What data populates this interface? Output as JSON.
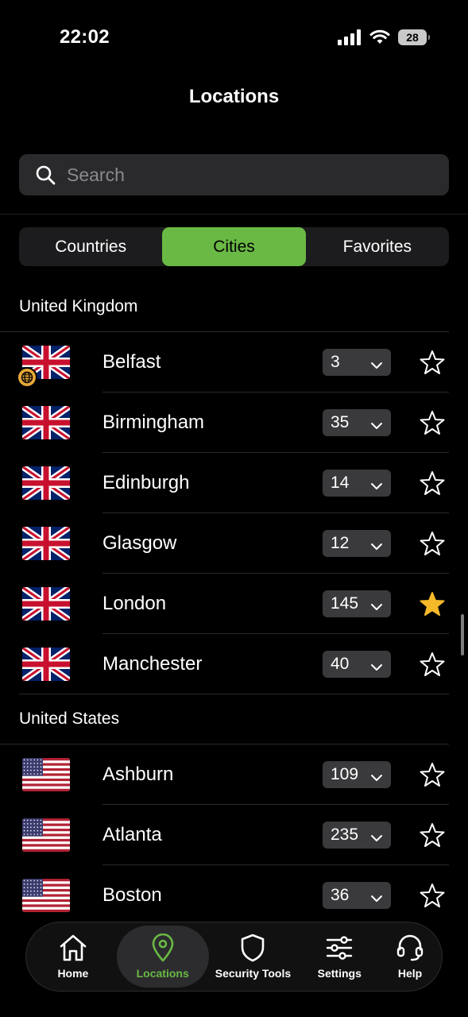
{
  "status_bar": {
    "time": "22:02",
    "battery": "28"
  },
  "page_title": "Locations",
  "search": {
    "placeholder": "Search",
    "value": ""
  },
  "tabs": [
    {
      "label": "Countries",
      "active": false
    },
    {
      "label": "Cities",
      "active": true
    },
    {
      "label": "Favorites",
      "active": false
    }
  ],
  "sections": [
    {
      "header": "United Kingdom",
      "flag": "uk-flag",
      "cities": [
        {
          "name": "Belfast",
          "servers": "3",
          "favorite": false,
          "badge": "globe-icon"
        },
        {
          "name": "Birmingham",
          "servers": "35",
          "favorite": false
        },
        {
          "name": "Edinburgh",
          "servers": "14",
          "favorite": false
        },
        {
          "name": "Glasgow",
          "servers": "12",
          "favorite": false
        },
        {
          "name": "London",
          "servers": "145",
          "favorite": true
        },
        {
          "name": "Manchester",
          "servers": "40",
          "favorite": false
        }
      ]
    },
    {
      "header": "United States",
      "flag": "us-flag",
      "cities": [
        {
          "name": "Ashburn",
          "servers": "109",
          "favorite": false
        },
        {
          "name": "Atlanta",
          "servers": "235",
          "favorite": false
        },
        {
          "name": "Boston",
          "servers": "36",
          "favorite": false
        }
      ]
    }
  ],
  "bottom_nav": [
    {
      "label": "Home",
      "icon": "home-icon",
      "active": false
    },
    {
      "label": "Locations",
      "icon": "location-pin-icon",
      "active": true
    },
    {
      "label": "Security Tools",
      "icon": "shield-icon",
      "active": false
    },
    {
      "label": "Settings",
      "icon": "sliders-icon",
      "active": false
    },
    {
      "label": "Help",
      "icon": "headset-icon",
      "active": false
    }
  ],
  "colors": {
    "accent": "#6ab945",
    "favorite_star": "#f5b829",
    "background": "#000000"
  }
}
